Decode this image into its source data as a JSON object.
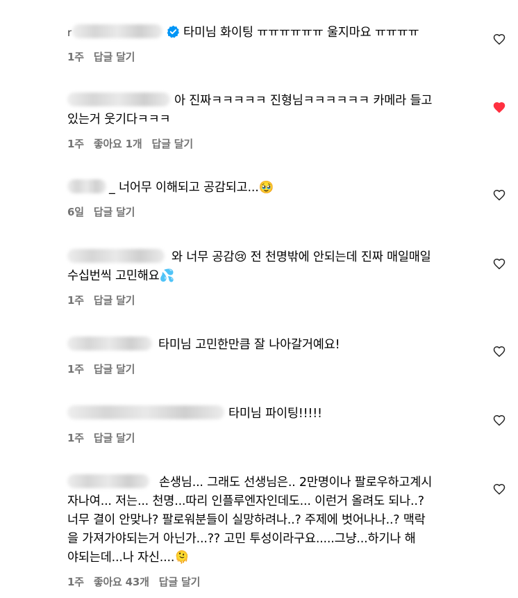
{
  "colors": {
    "heart_liked": "#ff3040",
    "meta_text": "#737373",
    "verified": "#0095f6"
  },
  "comments": [
    {
      "prefix": "r",
      "username_blurred": true,
      "verified": true,
      "text": "타미님 화이팅 ㅠㅠㅠㅠㅠㅠ 울지마요 ㅠㅠㅠㅠ",
      "time": "1주",
      "likes": "",
      "reply": "답글 달기",
      "liked": false,
      "heart_icon": "heart-outline-icon"
    },
    {
      "username_blurred": true,
      "text_line1": "아 진짜ㅋㅋㅋㅋㅋ 진형님ㅋㅋㅋㅋㅋㅋ 카메라 들고",
      "text_line2": "있는거 웃기다ㅋㅋㅋ",
      "time": "1주",
      "likes": "좋아요 1개",
      "reply": "답글 달기",
      "liked": true,
      "heart_icon": "heart-filled-icon"
    },
    {
      "username_blurred": true,
      "underscore": "_",
      "text": "너어무 이해되고 공감되고...🥹",
      "time": "6일",
      "likes": "",
      "reply": "답글 달기",
      "liked": false,
      "heart_icon": "heart-outline-icon"
    },
    {
      "username_blurred": true,
      "text_line1": "와 너무 공감😢 전 천명밖에 안되는데 진짜 매일매일",
      "text_line2": "수십번씩 고민해요💦",
      "time": "1주",
      "likes": "",
      "reply": "답글 달기",
      "liked": false,
      "heart_icon": "heart-outline-icon"
    },
    {
      "username_blurred": true,
      "text": "타미님 고민한만큼 잘 나아갈거예요!",
      "time": "1주",
      "likes": "",
      "reply": "답글 달기",
      "liked": false,
      "heart_icon": "heart-outline-icon"
    },
    {
      "username_blurred": true,
      "text": "타미님 파이팅!!!!!",
      "time": "1주",
      "likes": "",
      "reply": "답글 달기",
      "liked": false,
      "heart_icon": "heart-outline-icon"
    },
    {
      "username_blurred": true,
      "text_line1": "손생님... 그래도 선생님은.. 2만명이나 팔로우하고계시",
      "text_line2": "자나여... 저는... 천명...따리 인플루엔자인데도... 이런거 올려도 되나..?",
      "text_line3": "너무 결이 안맞나? 팔로워분들이 실망하려나..? 주제에 벗어나나..? 맥락",
      "text_line4": "을 가져가야되는거 아닌가...?? 고민 투성이라구요.....그냥...하기나 해",
      "text_line5": "야되는데...나 자신....🫠",
      "time": "1주",
      "likes": "좋아요 43개",
      "reply": "답글 달기",
      "liked": false,
      "heart_icon": "heart-outline-icon"
    }
  ]
}
